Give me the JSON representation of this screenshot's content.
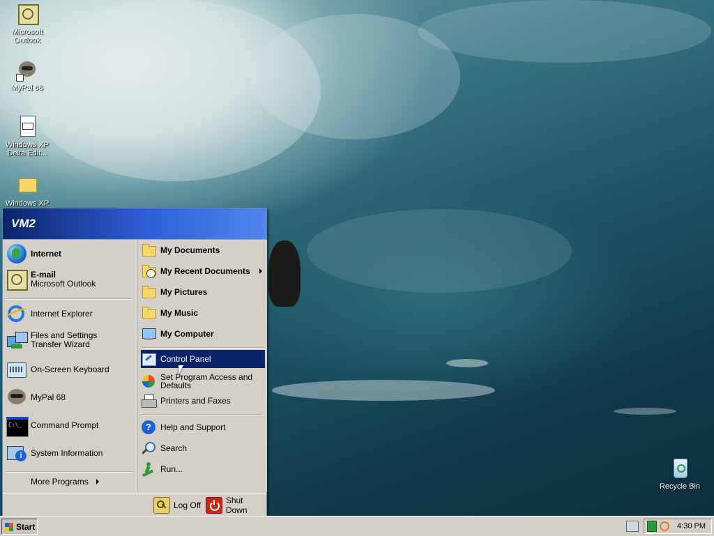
{
  "desktop": {
    "icons": [
      {
        "label": "Microsoft Outlook",
        "icon": "outlook-icon"
      },
      {
        "label": "MyPal 68",
        "icon": "raccoon-icon"
      },
      {
        "label": "Windows XP Delta Edit...",
        "icon": "document-icon"
      },
      {
        "label": "Windows XP",
        "icon": "folder-icon"
      },
      {
        "label": "Recycle Bin",
        "icon": "recycle-bin-icon"
      }
    ]
  },
  "start_menu": {
    "user": "VM2",
    "pinned": [
      {
        "title": "Internet",
        "subtitle": "",
        "icon": "globe-icon"
      },
      {
        "title": "E-mail",
        "subtitle": "Microsoft Outlook",
        "icon": "outlook-icon"
      }
    ],
    "recent": [
      {
        "label": "Internet Explorer",
        "icon": "ie-icon"
      },
      {
        "label": "Files and Settings Transfer Wizard",
        "icon": "transfer-wizard-icon"
      },
      {
        "label": "On-Screen Keyboard",
        "icon": "keyboard-icon"
      },
      {
        "label": "MyPal 68",
        "icon": "raccoon-icon"
      },
      {
        "label": "Command Prompt",
        "icon": "cmd-icon"
      },
      {
        "label": "System Information",
        "icon": "info-icon"
      }
    ],
    "more_programs": "More Programs",
    "places": [
      {
        "label": "My Documents",
        "icon": "folder-icon"
      },
      {
        "label": "My Recent Documents",
        "icon": "recent-docs-icon"
      },
      {
        "label": "My Pictures",
        "icon": "folder-icon"
      },
      {
        "label": "My Music",
        "icon": "folder-icon"
      },
      {
        "label": "My Computer",
        "icon": "computer-icon"
      }
    ],
    "settings": [
      {
        "label": "Control Panel",
        "icon": "control-panel-icon"
      },
      {
        "label": "Set Program Access and Defaults",
        "icon": "program-defaults-icon"
      },
      {
        "label": "Printers and Faxes",
        "icon": "printer-icon"
      }
    ],
    "tools": [
      {
        "label": "Help and Support",
        "icon": "help-icon"
      },
      {
        "label": "Search",
        "icon": "search-icon"
      },
      {
        "label": "Run...",
        "icon": "run-icon"
      }
    ],
    "log_off": "Log Off",
    "shut_down": "Shut Down"
  },
  "taskbar": {
    "start_label": "Start",
    "clock": "4:30 PM"
  },
  "colors": {
    "highlight": "#0a246a",
    "header_start": "#0a246a",
    "header_end": "#4f86ea",
    "menu_bg": "#d4d0c8"
  }
}
